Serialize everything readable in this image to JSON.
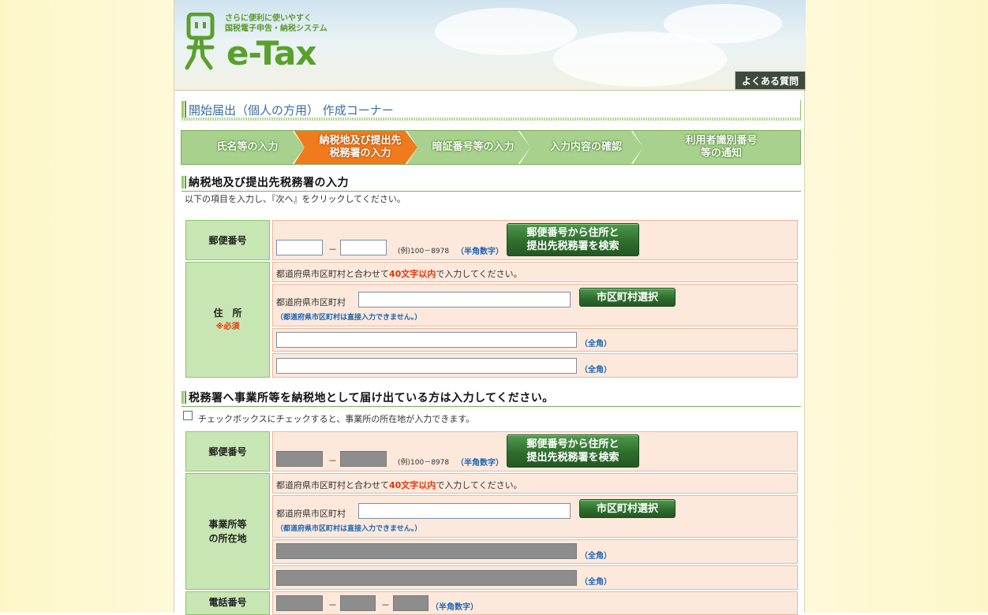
{
  "header": {
    "tagline_line1": "さらに便利に使いやすく",
    "tagline_line2": "国税電子申告・納税システム",
    "logo_text": "e-Tax",
    "faq_label": "よくある質問"
  },
  "page_title": "開始届出（個人の方用） 作成コーナー",
  "steps": [
    {
      "line1": "氏名等の入力",
      "line2": ""
    },
    {
      "line1": "納税地及び提出先",
      "line2": "税務署の入力"
    },
    {
      "line1": "暗証番号等の入力",
      "line2": ""
    },
    {
      "line1": "入力内容の確認",
      "line2": ""
    },
    {
      "line1": "利用者識別番号",
      "line2": "等の通知"
    }
  ],
  "section1": {
    "title": "納税地及び提出先税務署の入力",
    "instruction": "以下の項目を入力し、『次へ』をクリックしてください。",
    "postal_label": "郵便番号",
    "postal_example": "(例)100－8978",
    "postal_hint": "（半角数字）",
    "postal_search_btn_line1": "郵便番号から住所と",
    "postal_search_btn_line2": "提出先税務署を検索",
    "address_label": "住　所",
    "address_required": "※必須",
    "address_note_pre": "都道府県市区町村と合わせて",
    "address_note_red": "40文字以内",
    "address_note_post": "で入力してください。",
    "pref_label": "都道府県市区町村",
    "pref_note": "（都道府県市区町村は直接入力できません。）",
    "city_select_btn": "市区町村選択",
    "fullwidth_hint": "（全角）",
    "dash": "－"
  },
  "section2": {
    "title": "税務署へ事業所等を納税地として届け出ている方は入力してください。",
    "checkbox_label": "チェックボックスにチェックすると、事業所の所在地が入力できます。",
    "postal_label": "郵便番号",
    "postal_example": "(例)100－8978",
    "postal_hint": "（半角数字）",
    "postal_search_btn_line1": "郵便番号から住所と",
    "postal_search_btn_line2": "提出先税務署を検索",
    "office_label_line1": "事業所等",
    "office_label_line2": "の所在地",
    "address_note_pre": "都道府県市区町村と合わせて",
    "address_note_red": "40文字以内",
    "address_note_post": "で入力してください。",
    "pref_label": "都道府県市区町村",
    "pref_note": "（都道府県市区町村は直接入力できません。）",
    "city_select_btn": "市区町村選択",
    "fullwidth_hint": "（全角）",
    "phone_label": "電話番号",
    "phone_hint": "（半角数字）",
    "dash": "－"
  },
  "colors": {
    "label_bg": "#c8e6b4",
    "cell_bg": "#fde8dc",
    "active_step": "#f07a1c",
    "inactive_step": "#a8d18d",
    "accent_red": "#e8340c",
    "accent_blue": "#1a64b4"
  }
}
